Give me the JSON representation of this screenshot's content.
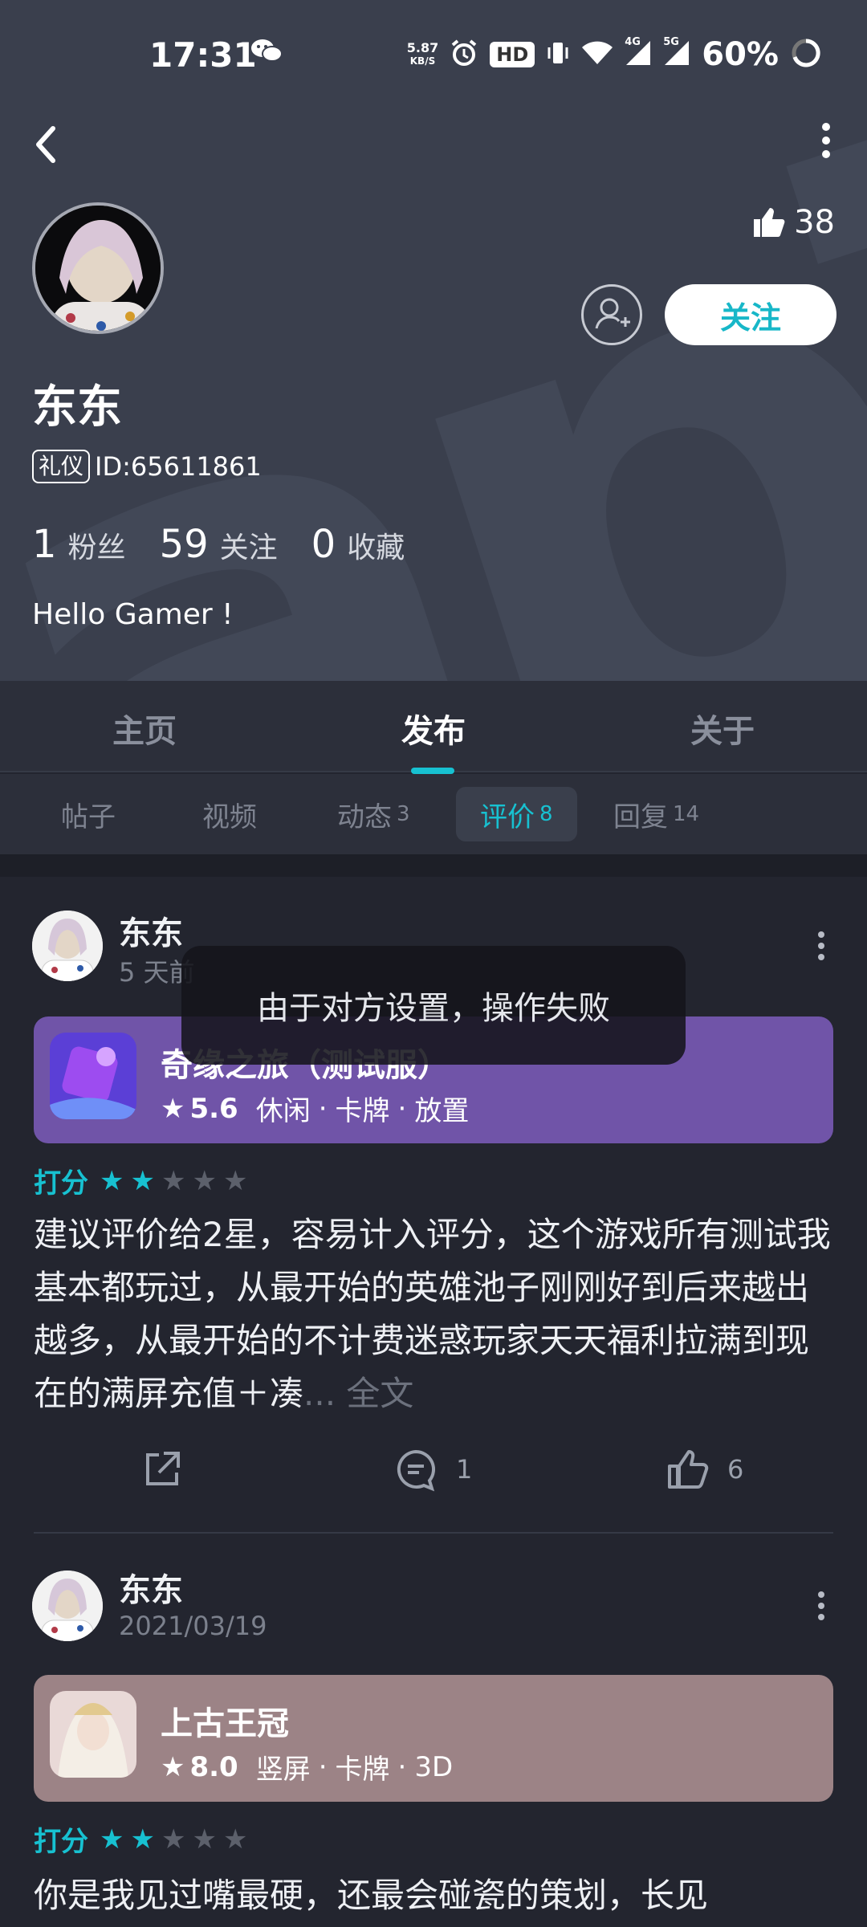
{
  "status_bar": {
    "time": "17:31",
    "net_speed_value": "5.87",
    "net_speed_unit": "KB/S",
    "hd_label": "HD",
    "signal_4g": "4G",
    "signal_5g": "5G",
    "battery": "60%"
  },
  "profile": {
    "watermark": "apTap",
    "likes": "38",
    "follow_label": "关注",
    "name": "东东",
    "badge": "礼仪",
    "id": "ID:65611861",
    "stats": [
      {
        "num": "1",
        "label": "粉丝"
      },
      {
        "num": "59",
        "label": "关注"
      },
      {
        "num": "0",
        "label": "收藏"
      }
    ],
    "bio": "Hello Gamer !"
  },
  "main_tabs": [
    "主页",
    "发布",
    "关于"
  ],
  "sub_tabs": [
    {
      "label": "帖子",
      "count": ""
    },
    {
      "label": "视频",
      "count": ""
    },
    {
      "label": "动态",
      "count": "3"
    },
    {
      "label": "评价",
      "count": "8"
    },
    {
      "label": "回复",
      "count": "14"
    }
  ],
  "reviews": [
    {
      "author": "东东",
      "time": "5 天前",
      "game": {
        "name": "奇缘之旅（测试服）",
        "score": "5.6",
        "tags": [
          "休闲",
          "卡牌",
          "放置"
        ],
        "card_color": "#7054a8"
      },
      "rating_label": "打分",
      "stars": 2,
      "text": "建议评价给2星，容易计入评分，这个游戏所有测试我基本都玩过，从最开始的英雄池子刚刚好到后来越出越多，从最开始的不计费迷惑玩家天天福利拉满到现在的满屏充值＋凑",
      "more": "... 全文",
      "comments": "1",
      "likes": "6"
    },
    {
      "author": "东东",
      "time": "2021/03/19",
      "game": {
        "name": "上古王冠",
        "score": "8.0",
        "tags": [
          "竖屏",
          "卡牌",
          "3D"
        ],
        "card_color": "#9c8386"
      },
      "rating_label": "打分",
      "stars": 2,
      "text": "你是我见过嘴最硬，还最会碰瓷的策划，长见"
    }
  ],
  "toast": "由于对方设置，操作失败"
}
